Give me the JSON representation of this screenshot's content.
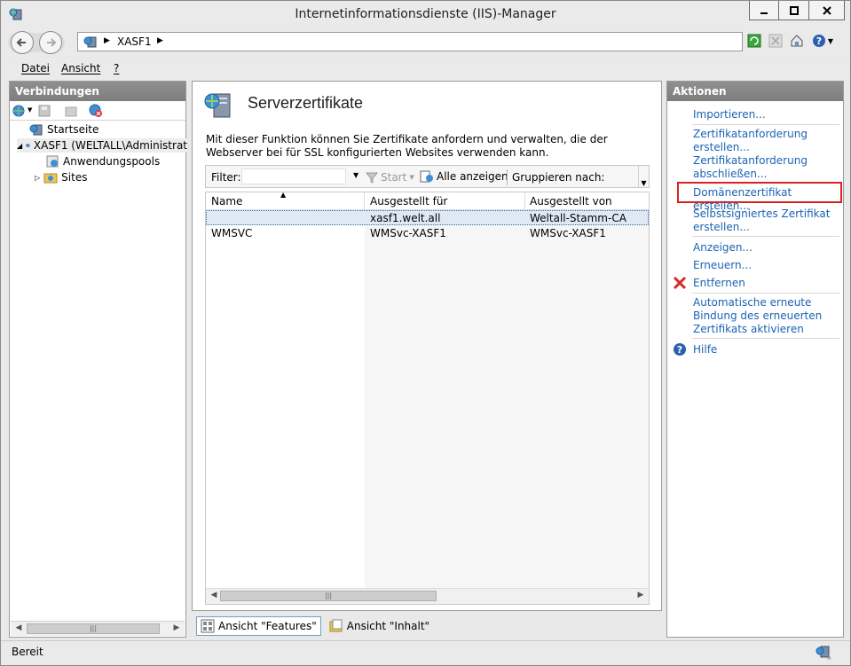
{
  "window": {
    "title": "Internetinformationsdienste (IIS)-Manager",
    "minimize_icon": "minimize-icon",
    "maximize_icon": "maximize-icon",
    "close_icon": "close-icon"
  },
  "address": {
    "crumbs": [
      "XASF1"
    ]
  },
  "menu": {
    "items": [
      "Datei",
      "Ansicht",
      "?"
    ]
  },
  "connections": {
    "header": "Verbindungen",
    "tree": {
      "start": "Startseite",
      "server": "XASF1 (WELTALL\\Administrat",
      "apppools": "Anwendungspools",
      "sites": "Sites"
    }
  },
  "main": {
    "title": "Serverzertifikate",
    "description": "Mit dieser Funktion können Sie Zertifikate anfordern und verwalten, die der Webserver bei für SSL konfigurierten Websites verwenden kann.",
    "filter": {
      "label": "Filter:",
      "start": "Start",
      "show_all": "Alle anzeigen",
      "group_by": "Gruppieren nach:"
    },
    "columns": [
      "Name",
      "Ausgestellt für",
      "Ausgestellt von"
    ],
    "rows": [
      {
        "name": "",
        "issued_to": "xasf1.welt.all",
        "issued_by": "Weltall-Stamm-CA"
      },
      {
        "name": "WMSVC",
        "issued_to": "WMSvc-XASF1",
        "issued_by": "WMSvc-XASF1"
      }
    ],
    "view_tabs": {
      "features": "Ansicht \"Features\"",
      "content": "Ansicht \"Inhalt\""
    }
  },
  "actions": {
    "header": "Aktionen",
    "import": "Importieren...",
    "create_request_1": "Zertifikatanforderung",
    "create_request_2": "erstellen...",
    "complete_request_1": "Zertifikatanforderung",
    "complete_request_2": "abschließen...",
    "create_domain": "Domänenzertifikat erstellen...",
    "create_selfsigned_1": "Selbstsigniertes Zertifikat",
    "create_selfsigned_2": "erstellen...",
    "view": "Anzeigen...",
    "renew": "Erneuern...",
    "remove": "Entfernen",
    "auto_renew_1": "Automatische erneute",
    "auto_renew_2": "Bindung des erneuerten",
    "auto_renew_3": "Zertifikats aktivieren",
    "help": "Hilfe"
  },
  "status": {
    "text": "Bereit"
  }
}
